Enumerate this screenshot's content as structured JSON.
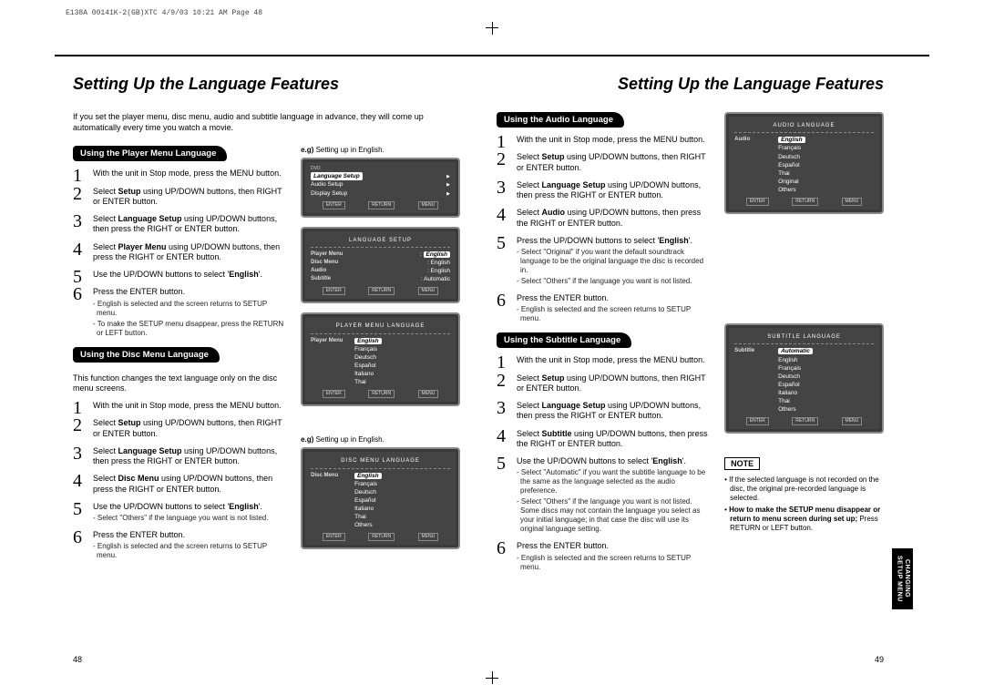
{
  "header": "E138A 00141K-2(GB)XTC  4/9/03 10:21 AM  Page 48",
  "title": "Setting Up the Language Features",
  "page_left_num": "48",
  "page_right_num": "49",
  "side_tab": {
    "line1": "CHANGING",
    "line2": "SETUP MENU"
  },
  "left": {
    "intro": "If you set the player menu, disc menu, audio and subtitle language in advance, they will come up automatically every time you watch a movie.",
    "sec1": {
      "tab": "Using the Player Menu Language",
      "eg": "Setting up in English.",
      "eg_prefix": "e.g)",
      "steps": [
        {
          "text": "With the unit in Stop mode, press the MENU button."
        },
        {
          "text": "Select <b>Setup</b> using UP/DOWN buttons, then RIGHT or ENTER button."
        },
        {
          "text": "Select <b>Language Setup</b> using UP/DOWN buttons, then press the RIGHT or ENTER button."
        },
        {
          "text": "Select <b>Player Menu</b> using UP/DOWN buttons, then press the RIGHT or ENTER button."
        },
        {
          "text": "Use the UP/DOWN buttons to select '<b>English</b>'."
        },
        {
          "text": "Press the ENTER button.",
          "subs": [
            "English is selected and the screen returns to SETUP menu.",
            "To make the SETUP menu disappear, press the RETURN or LEFT button."
          ]
        }
      ],
      "fig1": {
        "corner": "DVD",
        "rows": [
          {
            "l": "Language Setup",
            "arrow": true,
            "hl": true
          },
          {
            "l": "Audio Setup",
            "arrow": true
          },
          {
            "l": "Display Setup",
            "arrow": true
          }
        ],
        "btns": [
          "ENTER",
          "RETURN",
          "MENU"
        ]
      },
      "fig2": {
        "title": "LANGUAGE SETUP",
        "rows": [
          {
            "l": "Player Menu",
            "r": "English",
            "hl": true
          },
          {
            "l": "Disc Menu",
            "r": "English"
          },
          {
            "l": "Audio",
            "r": "English"
          },
          {
            "l": "Subtitle",
            "r": "Automatic"
          }
        ],
        "btns": [
          "ENTER",
          "RETURN",
          "MENU"
        ]
      },
      "fig3": {
        "title": "PLAYER MENU LANGUAGE",
        "left": "Player Menu",
        "opts": [
          "English",
          "Français",
          "Deutsch",
          "Español",
          "Italiano",
          "Thai"
        ],
        "hl": 0,
        "btns": [
          "ENTER",
          "RETURN",
          "MENU"
        ]
      }
    },
    "sec2": {
      "tab": "Using the Disc Menu Language",
      "intro": "This function changes the text language only on the disc menu screens.",
      "eg": "Setting up in English.",
      "eg_prefix": "e.g)",
      "steps": [
        {
          "text": "With the unit in Stop mode, press the MENU button."
        },
        {
          "text": "Select <b>Setup</b> using UP/DOWN buttons, then RIGHT or ENTER button."
        },
        {
          "text": "Select <b>Language Setup</b> using UP/DOWN buttons, then press the RIGHT or ENTER button."
        },
        {
          "text": "Select <b>Disc Menu</b> using UP/DOWN buttons, then press the RIGHT or ENTER button."
        },
        {
          "text": "Use the UP/DOWN buttons to select '<b>English</b>'.",
          "subs": [
            "Select \"Others\" if the language you want is not listed."
          ]
        },
        {
          "text": "Press the ENTER button.",
          "subs": [
            "English is selected and the screen returns to SETUP menu."
          ]
        }
      ],
      "fig": {
        "title": "DISC MENU LANGUAGE",
        "left": "Disc Menu",
        "opts": [
          "English",
          "Français",
          "Deutsch",
          "Español",
          "Italiano",
          "Thai",
          "Others"
        ],
        "hl": 0,
        "btns": [
          "ENTER",
          "RETURN",
          "MENU"
        ]
      }
    }
  },
  "right": {
    "sec1": {
      "tab": "Using the Audio Language",
      "steps": [
        {
          "text": "With the unit in Stop mode, press the MENU button."
        },
        {
          "text": "Select <b>Setup</b> using UP/DOWN buttons, then RIGHT or ENTER button."
        },
        {
          "text": "Select <b>Language Setup</b> using UP/DOWN buttons, then press the RIGHT or ENTER button."
        },
        {
          "text": "Select <b>Audio</b> using UP/DOWN buttons, then press the RIGHT or ENTER button."
        },
        {
          "text": "Press the UP/DOWN buttons to select '<b>English</b>'.",
          "subs": [
            "Select \"Original\" if you want the default soundtrack language to be the original language the disc is recorded in.",
            "Select \"Others\" if the language you want is not listed."
          ]
        },
        {
          "text": "Press the ENTER button.",
          "subs": [
            "English is selected and the screen returns to SETUP menu."
          ]
        }
      ],
      "fig": {
        "title": "AUDIO LANGUAGE",
        "left": "Audio",
        "opts": [
          "English",
          "Français",
          "Deutsch",
          "Español",
          "Thai",
          "Original",
          "Others"
        ],
        "hl": 0,
        "btns": [
          "ENTER",
          "RETURN",
          "MENU"
        ]
      }
    },
    "sec2": {
      "tab": "Using the Subtitle Language",
      "steps": [
        {
          "text": "With the unit in Stop mode, press the MENU button."
        },
        {
          "text": "Select <b>Setup</b> using UP/DOWN buttons, then RIGHT or ENTER button."
        },
        {
          "text": "Select <b>Language Setup</b> using UP/DOWN buttons, then press the RIGHT or ENTER button."
        },
        {
          "text": "Select <b>Subtitle</b> using UP/DOWN buttons, then press the RIGHT or ENTER button."
        },
        {
          "text": "Use the UP/DOWN buttons to select '<b>English</b>'.",
          "subs": [
            "Select \"Automatic\" if you want the subtitle language to be the same as the language selected as the audio preference.",
            "Select \"Others\" if the language you want is not listed. Some discs may not contain the language you select as your initial language; in that case the disc will use its original language setting."
          ]
        },
        {
          "text": "Press the ENTER button.",
          "subs": [
            "English is selected and the screen returns to SETUP menu."
          ]
        }
      ],
      "fig": {
        "title": "SUBTITLE LANGUAGE",
        "left": "Subtitle",
        "opts": [
          "Automatic",
          "English",
          "Français",
          "Deutsch",
          "Español",
          "Italiano",
          "Thai",
          "Others"
        ],
        "hl": 0,
        "btns": [
          "ENTER",
          "RETURN",
          "MENU"
        ]
      }
    },
    "note_label": "NOTE",
    "notes": [
      "If the selected language is not recorded on the disc, the original pre-recorded language is selected.",
      "<b>How to make the SETUP menu disappear or return to menu screen during set up;</b> Press RETURN or LEFT button."
    ]
  }
}
